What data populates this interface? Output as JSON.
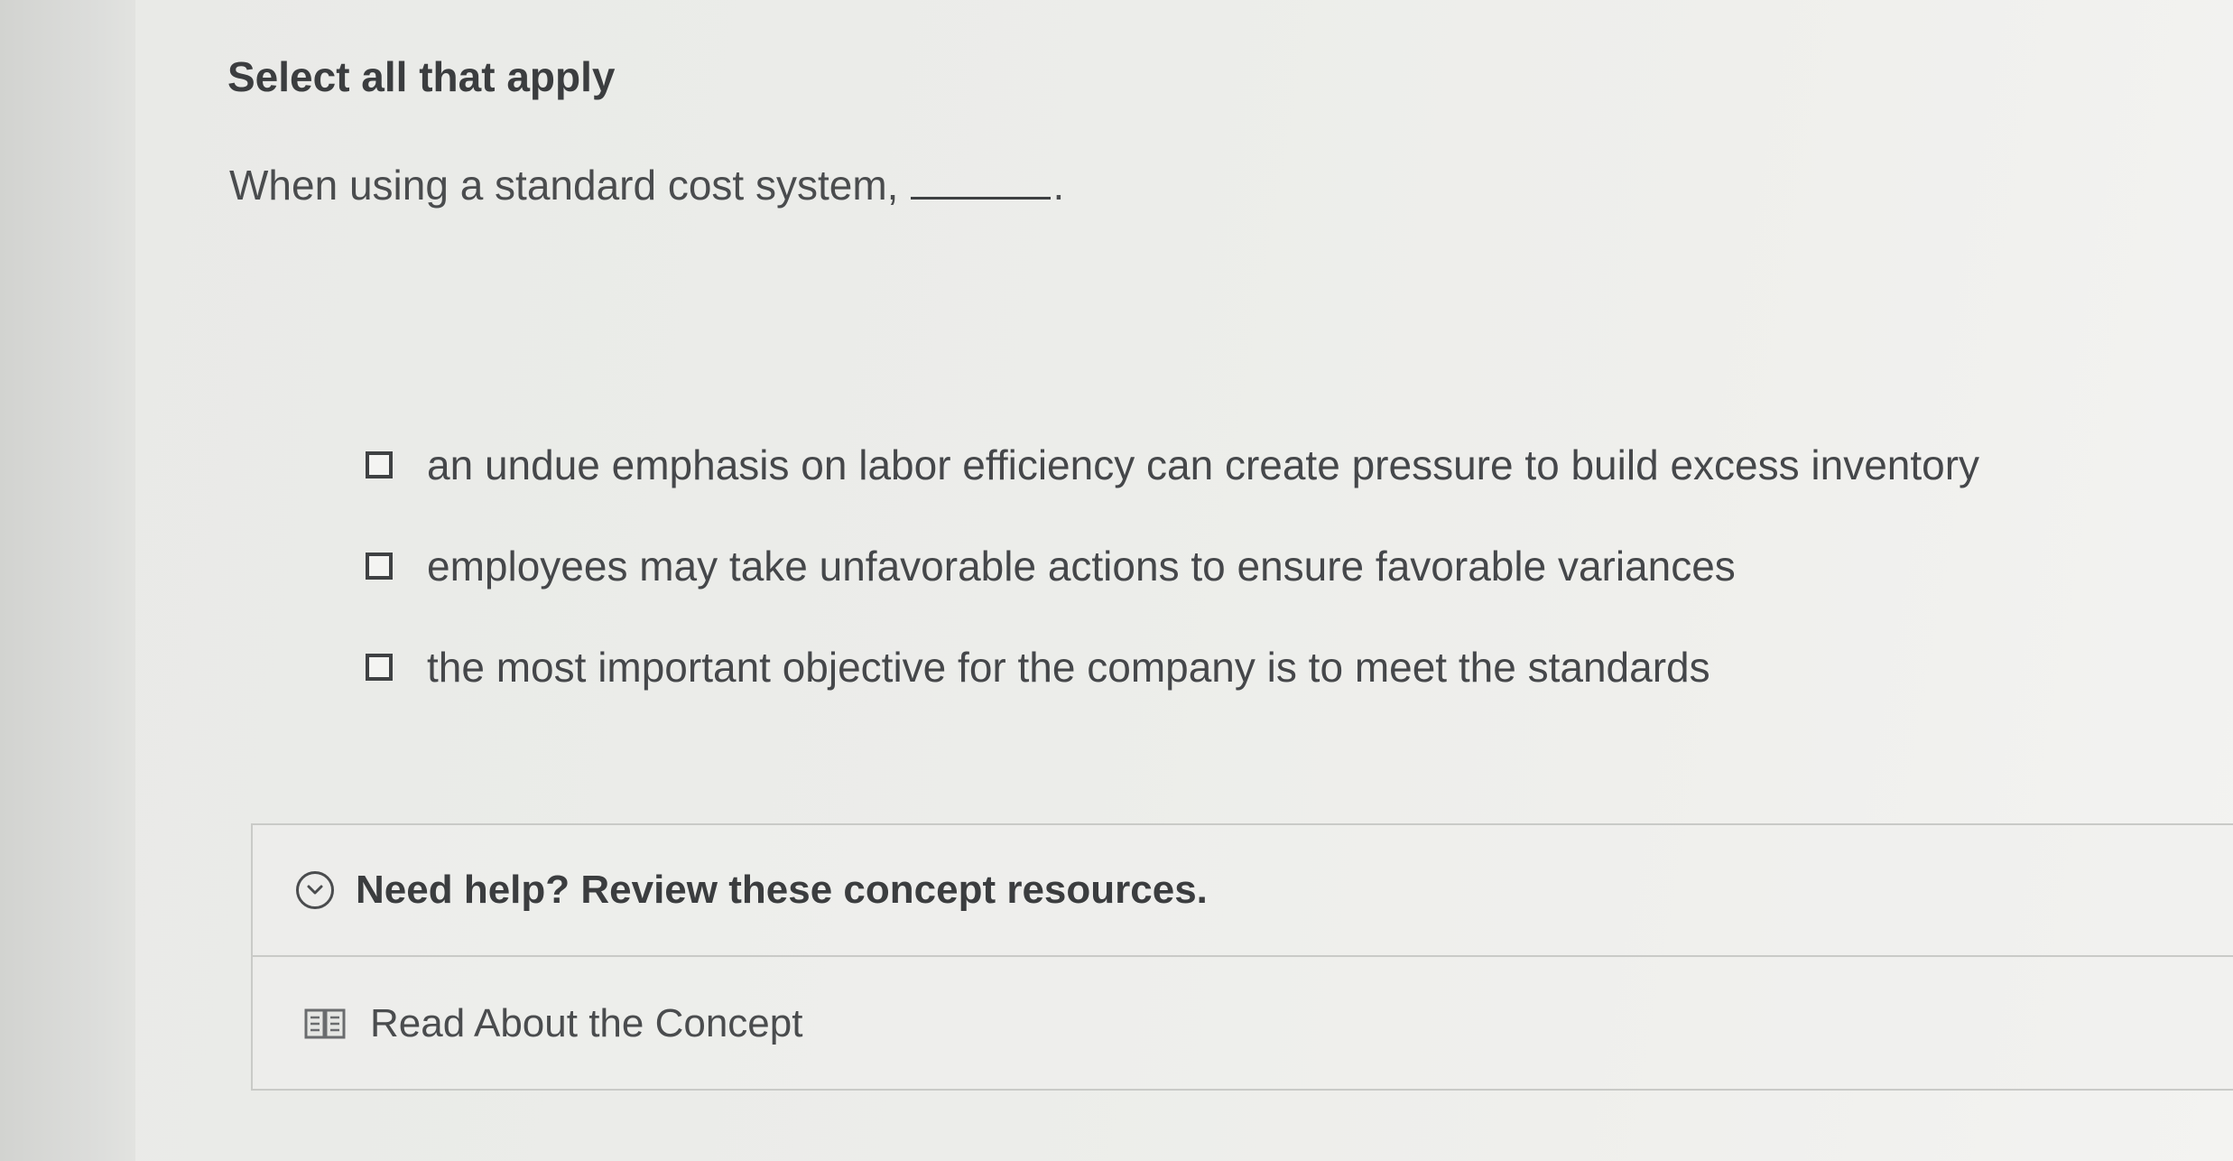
{
  "question": {
    "instruction": "Select all that apply",
    "stem": "When using a standard cost system,",
    "stem_end": "."
  },
  "choices": [
    {
      "label": "an undue emphasis on labor efficiency can create pressure to build excess inventory",
      "checked": false
    },
    {
      "label": "employees may take unfavorable actions to ensure favorable variances",
      "checked": false
    },
    {
      "label": "the most important objective for the company is to meet the standards",
      "checked": false
    }
  ],
  "help": {
    "title": "Need help? Review these concept resources.",
    "toggle_icon": "chevron-down-circle-icon",
    "resources": [
      {
        "label": "Read About the Concept",
        "icon": "book-icon"
      }
    ]
  },
  "colors": {
    "text": "#45474a",
    "heading": "#3b3d3f",
    "border": "#c9cac7"
  }
}
